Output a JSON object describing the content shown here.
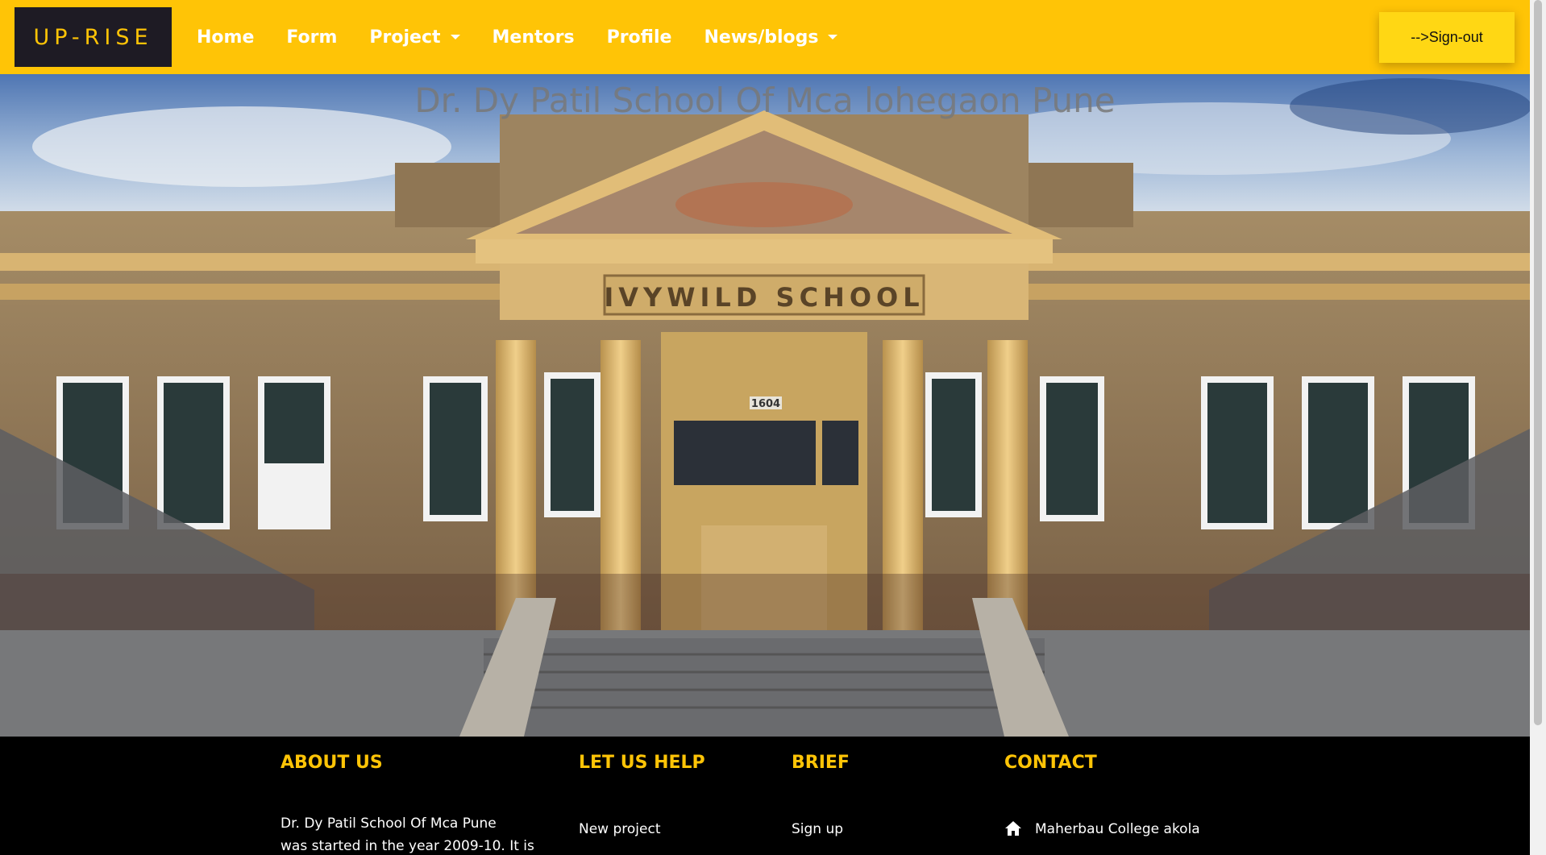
{
  "nav": {
    "brand": "UP-RISE",
    "items": [
      {
        "label": "Home",
        "dropdown": false
      },
      {
        "label": "Form",
        "dropdown": false
      },
      {
        "label": "Project",
        "dropdown": true
      },
      {
        "label": "Mentors",
        "dropdown": false
      },
      {
        "label": "Profile",
        "dropdown": false
      },
      {
        "label": "News/blogs",
        "dropdown": true
      }
    ],
    "signout_label": "-->Sign-out"
  },
  "hero": {
    "title": "Dr. Dy Patil School Of Mca lohegaon Pune",
    "building_sign": "IVYWILD SCHOOL",
    "building_number": "1604"
  },
  "footer": {
    "about": {
      "heading": "ABOUT US",
      "text_line1": "Dr. Dy Patil School Of Mca Pune",
      "text_line2": "was started in the year 2009-10. It is"
    },
    "help": {
      "heading": "LET US HELP",
      "link": "New project"
    },
    "brief": {
      "heading": "BRIEF",
      "link": "Sign up"
    },
    "contact": {
      "heading": "CONTACT",
      "address": "Maherbau College akola",
      "icon": "home-icon"
    }
  },
  "colors": {
    "accent": "#ffc406",
    "brand_bg": "#1e1b24",
    "footer_bg": "#000000"
  }
}
